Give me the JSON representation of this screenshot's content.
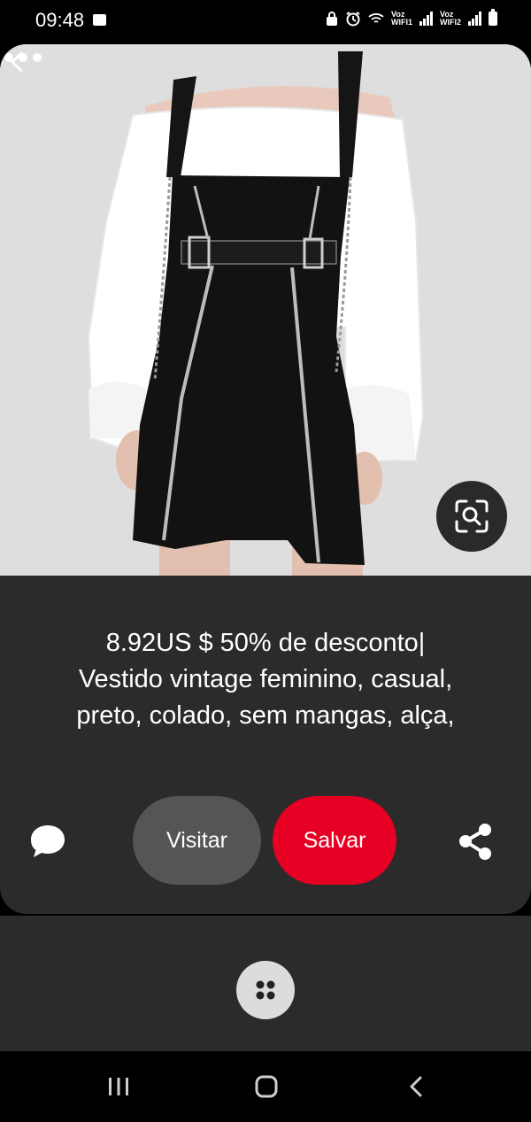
{
  "status_bar": {
    "time": "09:48",
    "sim1_label_top": "Voz",
    "sim1_label_bottom": "WIFI1",
    "sim2_label_top": "Voz",
    "sim2_label_bottom": "WIFI2",
    "icons": [
      "gallery-icon",
      "lock-icon",
      "alarm-icon",
      "wifi-icon",
      "signal-icon",
      "battery-icon"
    ]
  },
  "pin": {
    "image_subject": "black zip-front pinafore dress over white off-shoulder blouse",
    "title_lines": [
      "8.92US $ 50% de desconto|",
      "Vestido vintage feminino, casual,",
      "preto, colado, sem mangas, alça,"
    ]
  },
  "actions": {
    "visit_label": "Visitar",
    "save_label": "Salvar"
  },
  "colors": {
    "accent": "#e60023",
    "panel": "#2b2b2b",
    "visit_button": "#555555"
  }
}
